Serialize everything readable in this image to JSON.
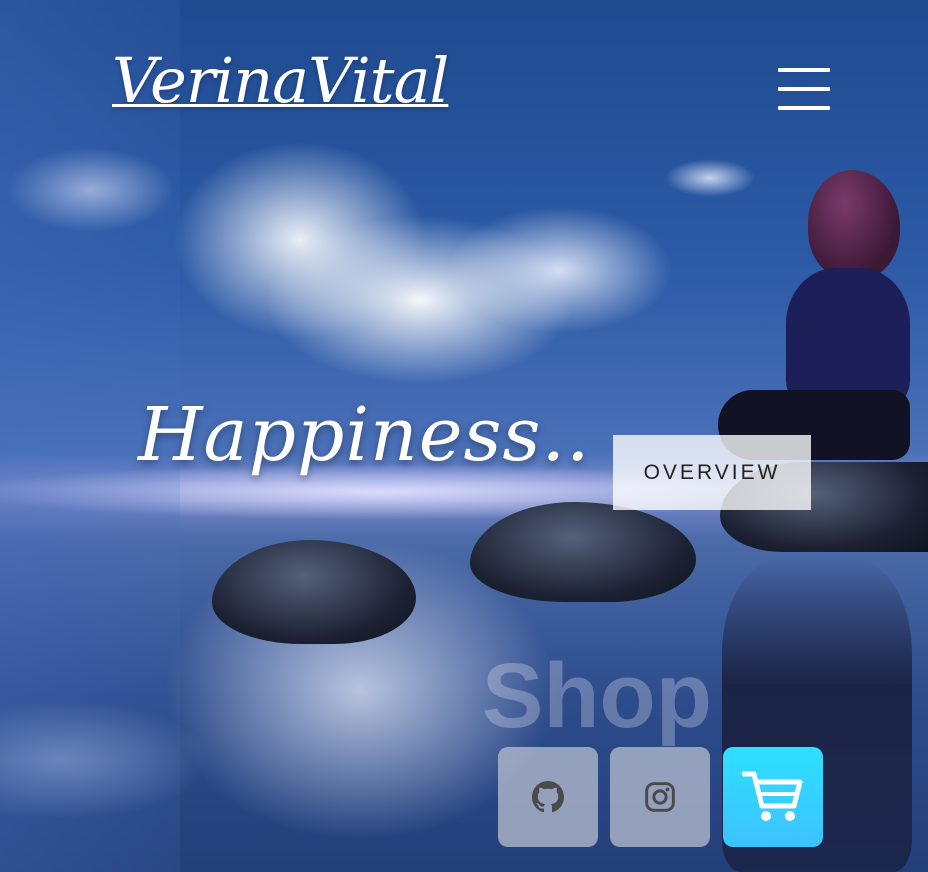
{
  "brand": {
    "name": "VerinaVital"
  },
  "nav": {
    "menu_icon": "hamburger-menu-icon"
  },
  "hero": {
    "headline": "Happiness..",
    "overview_label": "OVERVIEW"
  },
  "shop": {
    "label": "Shop",
    "buttons": [
      {
        "icon": "github-icon"
      },
      {
        "icon": "instagram-icon"
      },
      {
        "icon": "shopping-cart-icon",
        "accent": "#33d4ff"
      }
    ]
  }
}
